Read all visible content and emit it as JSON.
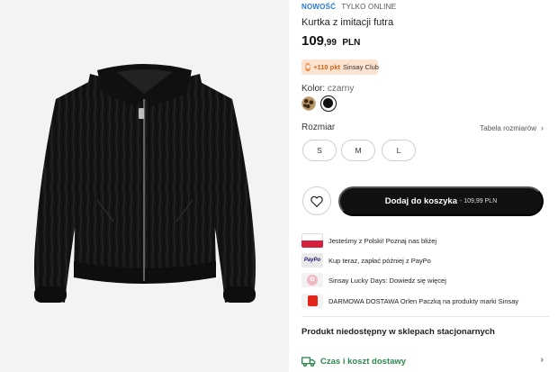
{
  "product": {
    "image_alt": "black faux fur jacket",
    "tags": {
      "new": "NOWOŚĆ",
      "online": "TYLKO ONLINE"
    },
    "title": "Kurtka z imitacji futra",
    "price": {
      "integer": "109",
      "decimal": ",99",
      "currency": "PLN"
    },
    "points": {
      "value": "+110 pkt",
      "program": "Sinsay Club"
    },
    "color": {
      "label": "Kolor:",
      "value": "czarny",
      "swatches": [
        "leopard-swatch",
        "black-swatch"
      ],
      "selected": "black-swatch"
    },
    "size": {
      "label": "Rozmiar",
      "table_link": "Tabela rozmiarów",
      "options": [
        "S",
        "M",
        "L"
      ]
    },
    "cart": {
      "label": "Dodaj do koszyka",
      "price": "- 109,99 PLN"
    },
    "promos": [
      {
        "icon": "poland-flag-icon",
        "text": "Jesteśmy z Polski! Poznaj nas bliżej"
      },
      {
        "icon": "paypo-logo",
        "logo_text": "PayPo",
        "text": "Kup teraz, zapłać później z PayPo"
      },
      {
        "icon": "lucky-days-logo",
        "text": "Sinsay Lucky Days: Dowiedz się więcej"
      },
      {
        "icon": "orlen-logo",
        "text": "DARMOWA DOSTAWA Orlen Paczką na produkty marki Sinsay"
      }
    ],
    "unavailable": "Produkt niedostępny w sklepach stacjonarnych",
    "delivery": "Czas i koszt dostawy"
  },
  "colors": {
    "accent_blue": "#2b7bd3",
    "points_orange": "#ef7d2c",
    "button_black": "#111111",
    "delivery_green": "#2e8a4d"
  }
}
